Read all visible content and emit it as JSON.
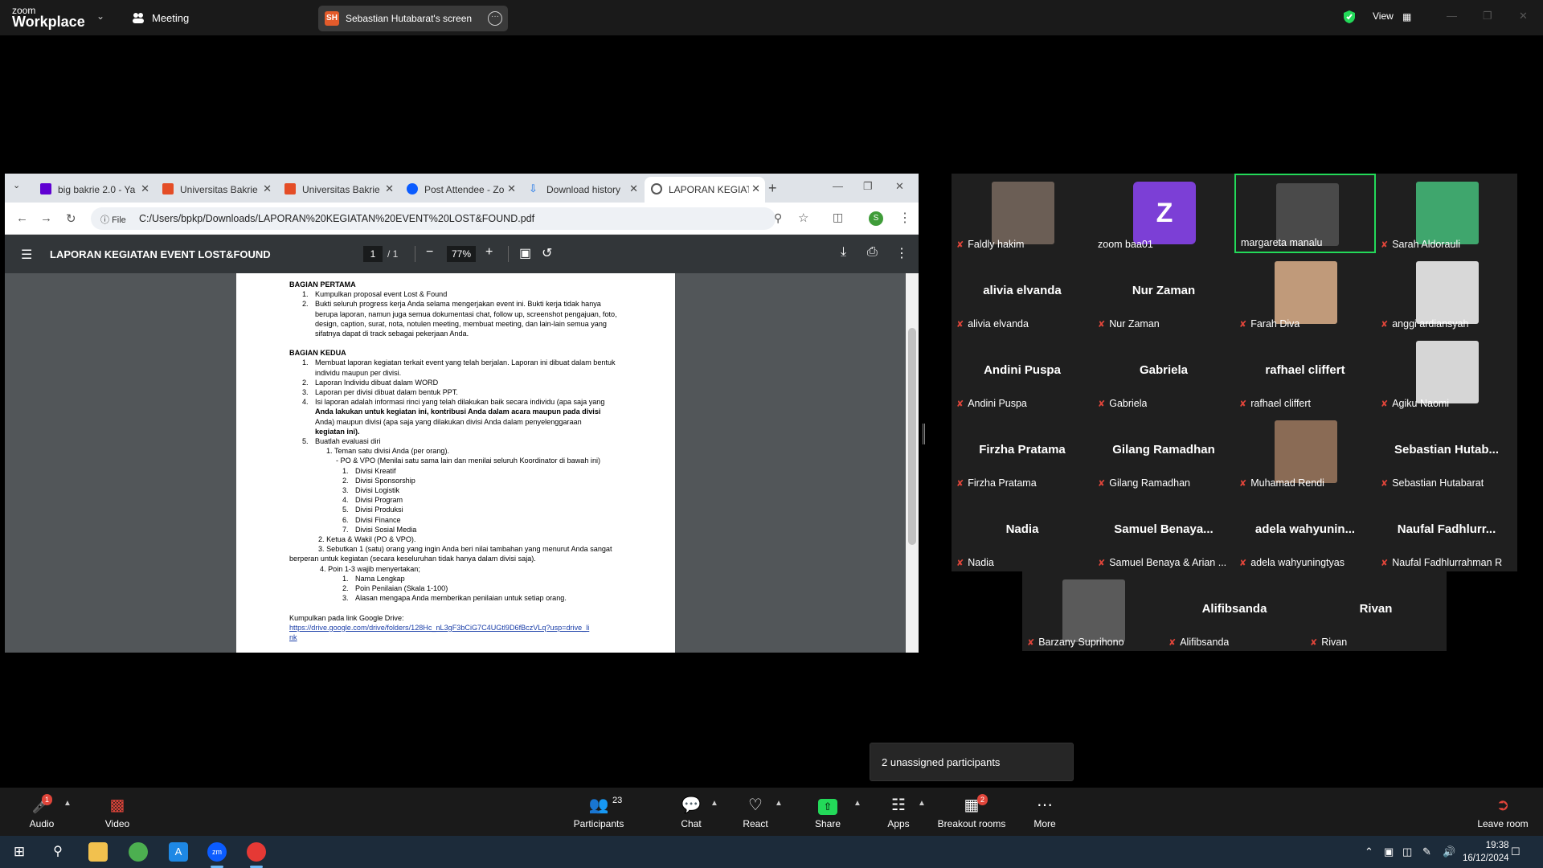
{
  "zoom_bar": {
    "logo_top": "zoom",
    "logo_bottom": "Workplace",
    "meeting_label": "Meeting",
    "screen_initials": "SH",
    "screen_label": "Sebastian Hutabarat's screen",
    "view_label": "View",
    "accent": "#23d959"
  },
  "browser": {
    "tabs": [
      {
        "label": "big bakrie 2.0 - Ya",
        "icon_color": "#6001d2"
      },
      {
        "label": "Universitas Bakrie",
        "icon_color": "#e44d26"
      },
      {
        "label": "Universitas Bakrie",
        "icon_color": "#e44d26"
      },
      {
        "label": "Post Attendee - Zo",
        "icon_color": "#0b5cff"
      },
      {
        "label": "Download history",
        "icon_color": "#1a73e8"
      },
      {
        "label": "LAPORAN KEGIATA",
        "icon_color": "#555555"
      }
    ],
    "url_prefix": "File",
    "url": "C:/Users/bpkp/Downloads/LAPORAN%20KEGIATAN%20EVENT%20LOST&FOUND.pdf",
    "profile_initial": "S"
  },
  "pdf": {
    "title": "LAPORAN KEGIATAN EVENT LOST&FOUND",
    "page_current": "1",
    "page_total": "/   1",
    "zoom": "77%",
    "content": {
      "part1_title": "BAGIAN PERTAMA",
      "p1_1": "Kumpulkan proposal event Lost & Found",
      "p1_2a": "Bukti seluruh progress kerja Anda selama mengerjakan event ini. Bukti kerja tidak hanya",
      "p1_2b": "berupa laporan, namun juga semua dokumentasi chat, follow up, screenshot pengajuan, foto,",
      "p1_2c": "design, caption, surat, nota, notulen meeting, membuat meeting, dan lain-lain semua yang",
      "p1_2d": "sifatnya dapat di track sebagai pekerjaan Anda.",
      "part2_title": "BAGIAN KEDUA",
      "p2_1a": "Membuat laporan kegiatan terkait event yang telah berjalan. Laporan ini dibuat dalam bentuk",
      "p2_1b": "individu maupun per divisi.",
      "p2_2": "Laporan Individu dibuat dalam WORD",
      "p2_3": "Laporan per divisi dibuat dalam bentuk PPT.",
      "p2_4a": "Isi laporan adalah informasi rinci yang telah dilakukan baik secara individu (apa saja yang",
      "p2_4b": "Anda lakukan untuk kegiatan ini, kontribusi Anda dalam acara maupun pada divisi",
      "p2_4c": "Anda) maupun divisi (apa saja yang dilakukan divisi Anda dalam penyelenggaraan",
      "p2_4d": "kegiatan ini).",
      "p2_5": "Buatlah evaluasi diri",
      "p2_5_1": "1.   Teman satu divisi Anda (per orang).",
      "p2_5_po": "-     PO & VPO (Menilai satu sama lain dan menilai seluruh Koordinator di bawah ini)",
      "divisions": [
        "Divisi Kreatif",
        "Divisi Sponsorship",
        "Divisi Logistik",
        "Divisi Program",
        "Divisi Produksi",
        "Divisi Finance",
        "Divisi Sosial Media"
      ],
      "p2_5_2": "2. Ketua & Wakil (PO & VPO).",
      "p2_5_3a": "3. Sebutkan 1 (satu) orang yang ingin Anda beri nilai tambahan yang menurut Anda sangat",
      "p2_5_3b": "berperan untuk kegiatan (secara keseluruhan tidak hanya dalam divisi saja).",
      "p2_5_4": "4. Poin 1-3 wajib menyertakan;",
      "points": [
        "Nama Lengkap",
        "Poin Penilaian (Skala 1-100)",
        "Alasan mengapa Anda memberikan penilaian untuk setiap orang."
      ],
      "drive_label": "Kumpulkan pada link Google Drive:",
      "drive_link_a": "https://drive.google.com/drive/folders/128Hc_nL3gF3bCiG7C4UGtl9D6fBczVLq?usp=drive_li",
      "drive_link_b": "nk"
    }
  },
  "participants": [
    {
      "label": "Faldly hakim",
      "name": "",
      "photo": "#6b5e55"
    },
    {
      "label": "zoom baa01",
      "name": "",
      "avatar": "Z",
      "nomic": true
    },
    {
      "label": "margareta manalu",
      "name": "",
      "photo": "#4a4a4a",
      "nomic": true,
      "speaking": true
    },
    {
      "label": "Sarah Aldorauli",
      "name": "",
      "photo": "#3fa66d"
    },
    {
      "label": "alivia elvanda",
      "name": "alivia elvanda"
    },
    {
      "label": "Nur Zaman",
      "name": "Nur Zaman"
    },
    {
      "label": "Farah Diva",
      "name": "",
      "photo": "#c09a7a"
    },
    {
      "label": "anggi ardiansyah",
      "name": "",
      "photo": "#d8d8d8"
    },
    {
      "label": "Andini Puspa",
      "name": "Andini Puspa"
    },
    {
      "label": "Gabriela",
      "name": "Gabriela"
    },
    {
      "label": "rafhael cliffert",
      "name": "rafhael cliffert"
    },
    {
      "label": "Agiku Naomi",
      "name": "",
      "photo": "#d6d6d6"
    },
    {
      "label": "Firzha Pratama",
      "name": "Firzha Pratama"
    },
    {
      "label": "Gilang Ramadhan",
      "name": "Gilang Ramadhan"
    },
    {
      "label": "Muhamad Rendi",
      "name": "",
      "photo": "#8a6b55"
    },
    {
      "label": "Sebastian Hutabarat",
      "name": "Sebastian  Hutab..."
    },
    {
      "label": "Nadia",
      "name": "Nadia"
    },
    {
      "label": "Samuel Benaya & Arian ...",
      "name": "Samuel  Benaya..."
    },
    {
      "label": "adela wahyuningtyas",
      "name": "adela  wahyunin..."
    },
    {
      "label": "Naufal Fadhlurrahman R",
      "name": "Naufal  Fadhlurr..."
    },
    {
      "label": "Barzany Suprihono",
      "name": "",
      "photo": "#5a5a5a"
    },
    {
      "label": "Alifibsanda",
      "name": "Alifibsanda"
    },
    {
      "label": "Rivan",
      "name": "Rivan"
    }
  ],
  "unassigned": "2 unassigned participants",
  "controls": {
    "audio": "Audio",
    "video": "Video",
    "participants": "Participants",
    "participants_count": "23",
    "chat": "Chat",
    "react": "React",
    "share": "Share",
    "apps": "Apps",
    "breakout": "Breakout rooms",
    "breakout_badge": "2",
    "more": "More",
    "leave": "Leave room",
    "audio_badge": "1"
  },
  "taskbar": {
    "time": "19:38",
    "date": "16/12/2024"
  }
}
